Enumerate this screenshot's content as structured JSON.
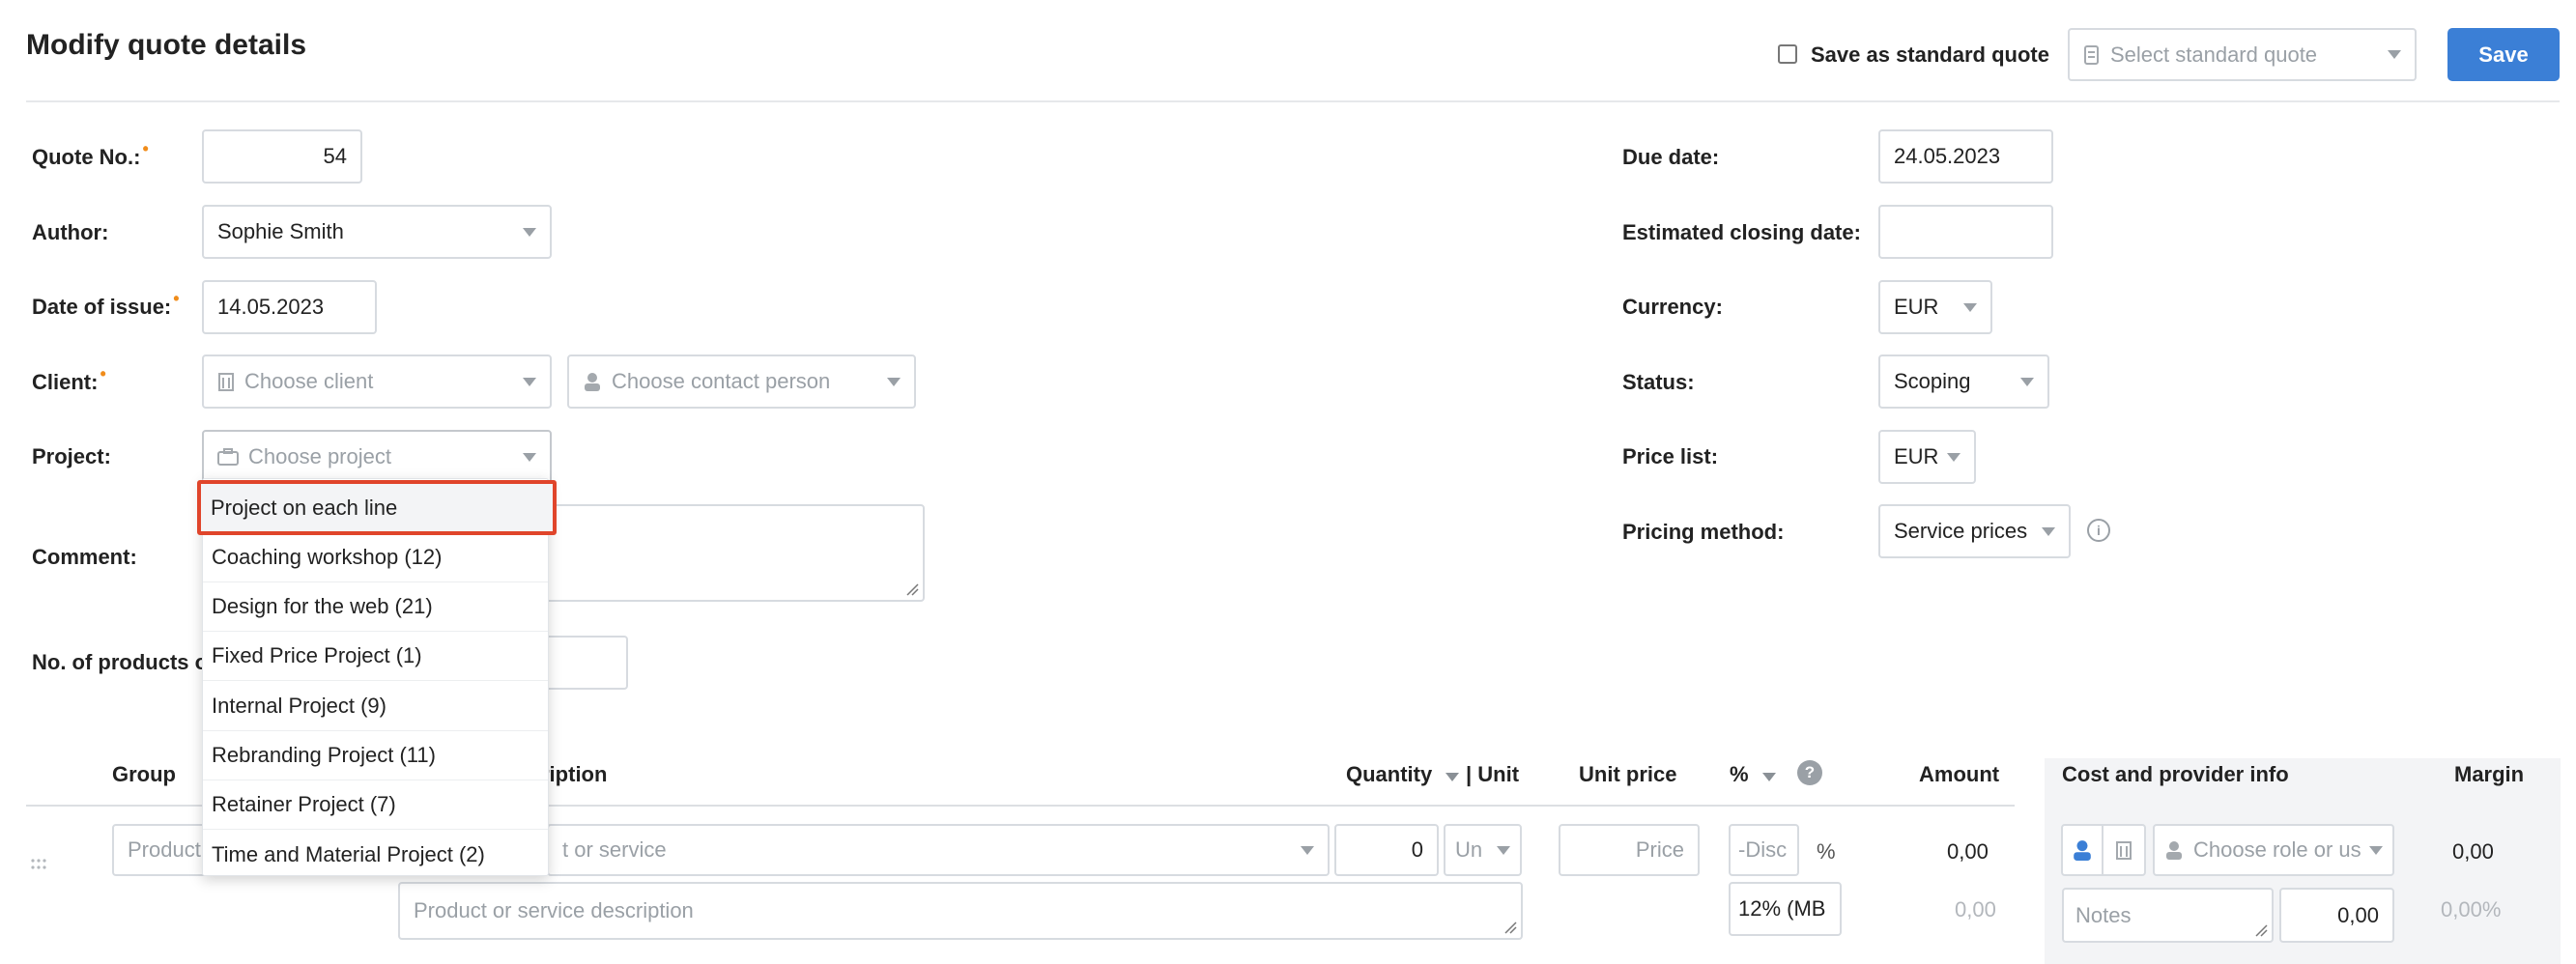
{
  "header": {
    "title": "Modify quote details",
    "save_as_standard_label": "Save as standard quote",
    "standard_quote_placeholder": "Select standard quote",
    "save_label": "Save"
  },
  "left_form": {
    "quote_no_label": "Quote No.:",
    "quote_no_value": "54",
    "author_label": "Author:",
    "author_value": "Sophie Smith",
    "date_issue_label": "Date of issue:",
    "date_issue_value": "14.05.2023",
    "client_label": "Client:",
    "client_placeholder": "Choose client",
    "contact_placeholder": "Choose contact person",
    "project_label": "Project:",
    "project_placeholder": "Choose project",
    "comment_label": "Comment:",
    "products_label": "No. of products o"
  },
  "required_marker": "•",
  "right_form": {
    "due_date_label": "Due date:",
    "due_date_value": "24.05.2023",
    "est_closing_label": "Estimated closing date:",
    "est_closing_value": "",
    "currency_label": "Currency:",
    "currency_value": "EUR",
    "status_label": "Status:",
    "status_value": "Scoping",
    "price_list_label": "Price list:",
    "price_list_value": "EUR",
    "pricing_method_label": "Pricing method:",
    "pricing_method_value": "Service prices",
    "info_glyph": "i"
  },
  "project_dropdown": {
    "items": [
      "Project on each line",
      "Coaching workshop (12)",
      "Design for the web (21)",
      "Fixed Price Project (1)",
      "Internal Project (9)",
      "Rebranding Project (11)",
      "Retainer Project (7)",
      "Time and Material Project (2)"
    ],
    "highlighted_index": 0
  },
  "table": {
    "headers": {
      "group": "Group",
      "description": "ription",
      "quantity": "Quantity",
      "unit": "| Unit",
      "unit_price": "Unit price",
      "percent": "%",
      "help_glyph": "?",
      "amount": "Amount",
      "cost_info": "Cost and provider info",
      "margin": "Margin"
    },
    "row": {
      "product_placeholder": "Product",
      "product_service_placeholder": "t or service",
      "quantity_value": "0",
      "unit_placeholder": "Un",
      "price_placeholder": "Price",
      "discount_placeholder": "-Disc",
      "percent_sign": "%",
      "amount_value": "0,00",
      "description_placeholder": "Product or service description",
      "vat_value": "12% (MB",
      "amount_secondary": "0,00",
      "role_placeholder": "Choose role or us",
      "notes_placeholder": "Notes",
      "cost_value": "0,00",
      "margin_value": "0,00",
      "margin_pct": "0,00%"
    }
  },
  "colors": {
    "accent": "#3b7fd6",
    "required": "#f08c1a",
    "highlight_border": "#e0452b"
  },
  "icons": {
    "standard_quote": "document-icon",
    "client": "building-icon",
    "contact": "person-icon",
    "project": "briefcase-icon",
    "drag": "drag-handle-icon"
  }
}
